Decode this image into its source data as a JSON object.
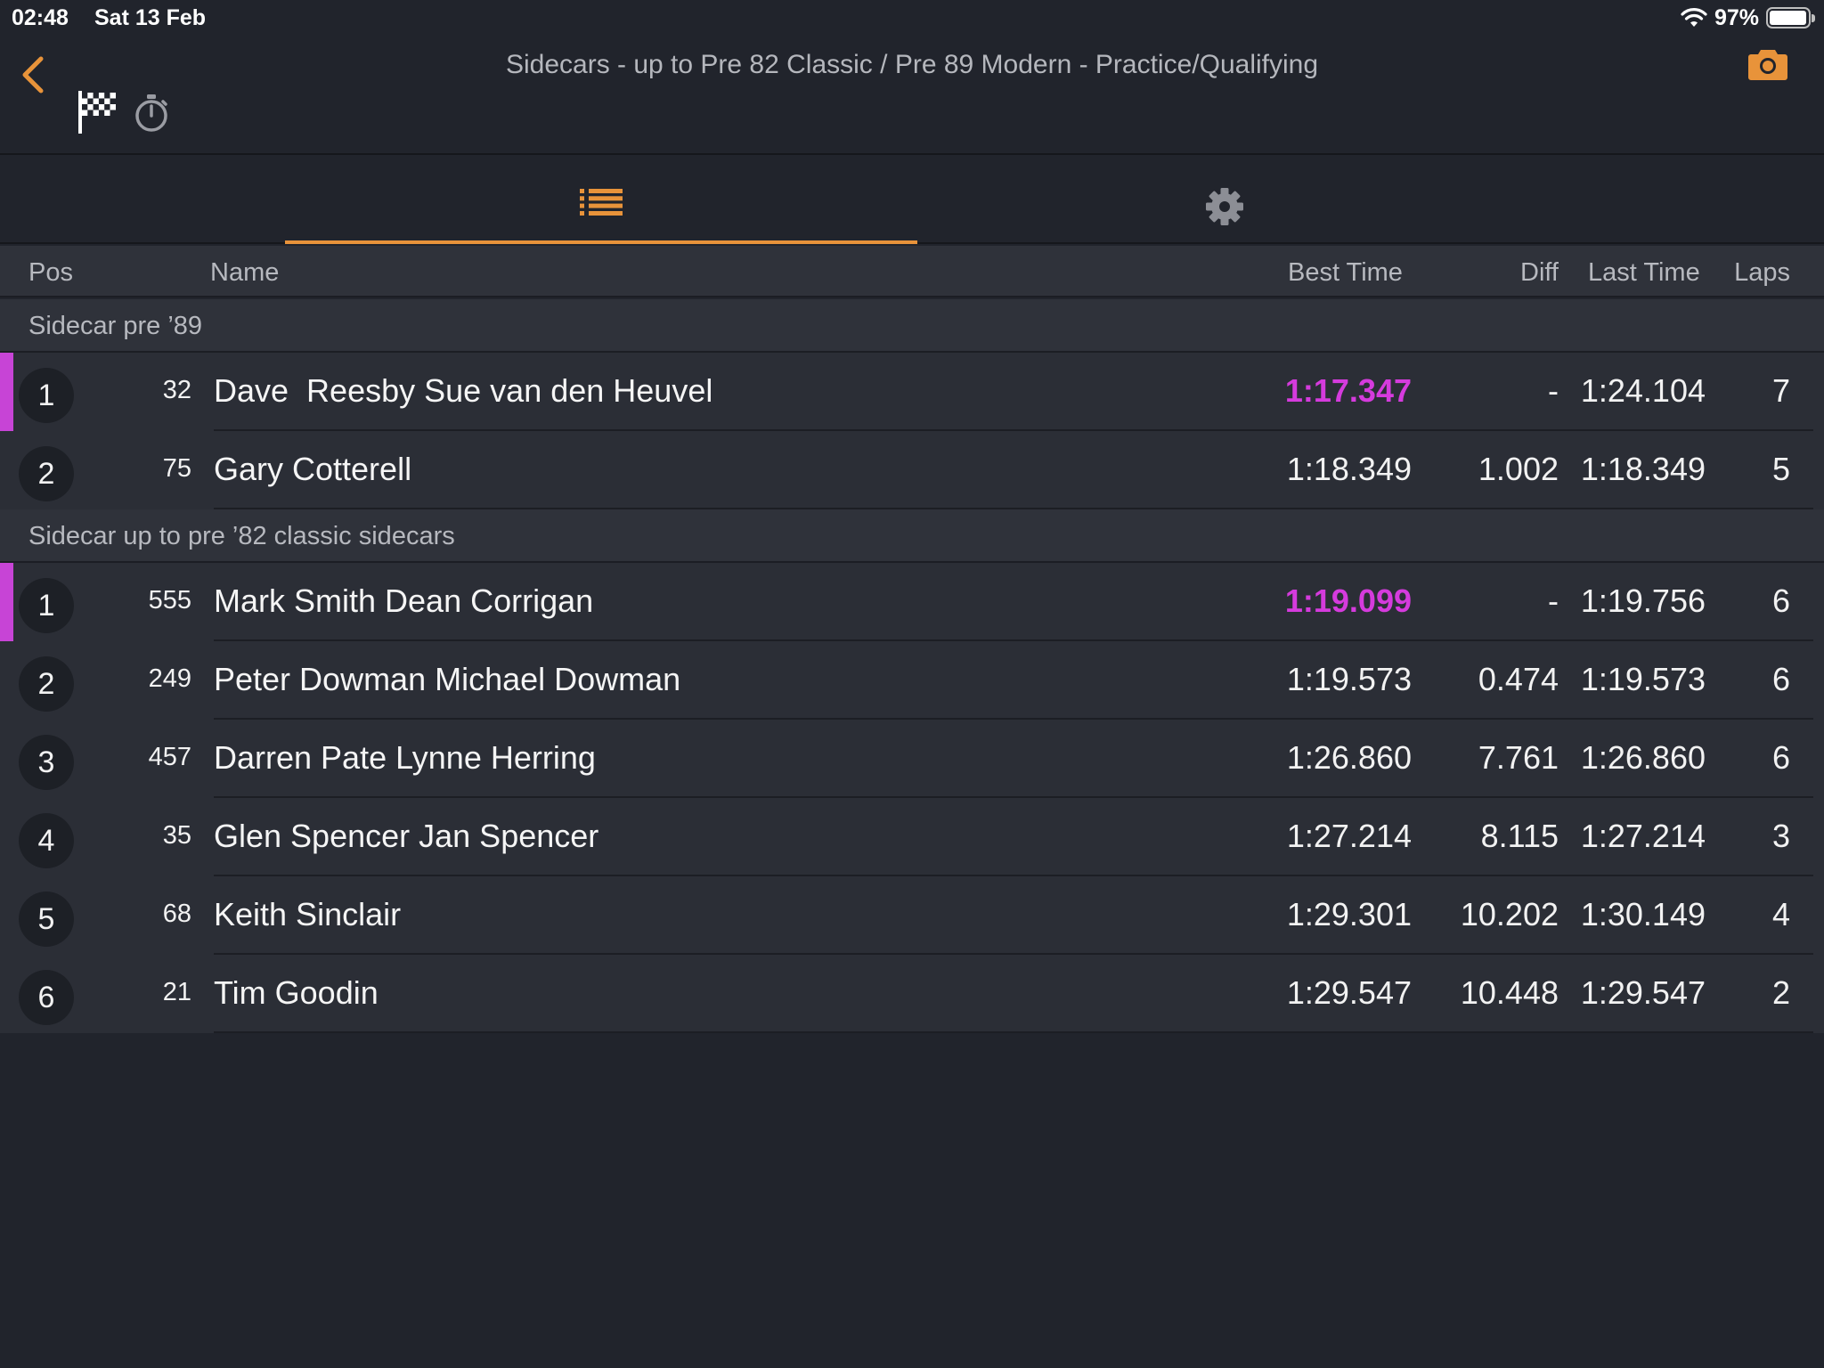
{
  "status_bar": {
    "time": "02:48",
    "date": "Sat 13 Feb",
    "battery": "97%",
    "battery_level": 0.97
  },
  "header": {
    "title": "Sidecars - up to Pre 82 Classic / Pre 89 Modern - Practice/Qualifying"
  },
  "colors": {
    "accent": "#e8933a",
    "fastest": "#d53bdd",
    "background": "#21242c",
    "row": "#2b2e36",
    "header_row": "#2f323a"
  },
  "tabs": [
    {
      "icon": "list-icon",
      "active": true
    },
    {
      "icon": "gear-icon",
      "active": false
    }
  ],
  "columns": {
    "pos": "Pos",
    "name": "Name",
    "best": "Best Time",
    "diff": "Diff",
    "last": "Last Time",
    "laps": "Laps"
  },
  "groups": [
    {
      "title": "Sidecar pre ’89",
      "rows": [
        {
          "pos": "1",
          "num": "32",
          "name": "Dave  Reesby Sue van den Heuvel",
          "best": "1:17.347",
          "diff": "-",
          "last": "1:24.104",
          "laps": "7",
          "leader": true
        },
        {
          "pos": "2",
          "num": "75",
          "name": "Gary Cotterell",
          "best": "1:18.349",
          "diff": "1.002",
          "last": "1:18.349",
          "laps": "5",
          "leader": false
        }
      ]
    },
    {
      "title": "Sidecar up to pre ’82 classic sidecars",
      "rows": [
        {
          "pos": "1",
          "num": "555",
          "name": "Mark Smith Dean Corrigan",
          "best": "1:19.099",
          "diff": "-",
          "last": "1:19.756",
          "laps": "6",
          "leader": true
        },
        {
          "pos": "2",
          "num": "249",
          "name": "Peter Dowman Michael Dowman",
          "best": "1:19.573",
          "diff": "0.474",
          "last": "1:19.573",
          "laps": "6",
          "leader": false
        },
        {
          "pos": "3",
          "num": "457",
          "name": "Darren Pate Lynne Herring",
          "best": "1:26.860",
          "diff": "7.761",
          "last": "1:26.860",
          "laps": "6",
          "leader": false
        },
        {
          "pos": "4",
          "num": "35",
          "name": "Glen Spencer Jan Spencer",
          "best": "1:27.214",
          "diff": "8.115",
          "last": "1:27.214",
          "laps": "3",
          "leader": false
        },
        {
          "pos": "5",
          "num": "68",
          "name": "Keith Sinclair",
          "best": "1:29.301",
          "diff": "10.202",
          "last": "1:30.149",
          "laps": "4",
          "leader": false
        },
        {
          "pos": "6",
          "num": "21",
          "name": "Tim Goodin",
          "best": "1:29.547",
          "diff": "10.448",
          "last": "1:29.547",
          "laps": "2",
          "leader": false
        }
      ]
    }
  ]
}
